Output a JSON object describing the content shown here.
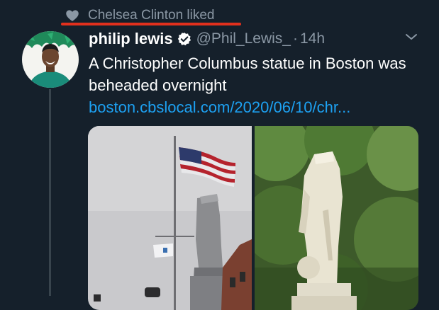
{
  "social_context": {
    "icon": "heart-icon",
    "text": "Chelsea Clinton liked"
  },
  "tweet": {
    "author": {
      "display_name": "philip lewis",
      "handle": "@Phil_Lewis_",
      "verified": true,
      "avatar": "avatar"
    },
    "separator": "·",
    "time": "14h",
    "text": "A Christopher Columbus statue in Boston was beheaded overnight",
    "link": "boston.cbslocal.com/2020/06/10/chr...",
    "media": [
      {
        "icon": "statue-photo-flag"
      },
      {
        "icon": "statue-photo-trees"
      }
    ]
  },
  "colors": {
    "background": "#15202b",
    "primary_text": "#ffffff",
    "secondary_text": "#8b98a5",
    "link": "#1da1f2",
    "verified": "#ffffff",
    "annotation_underline": "#e2301d"
  }
}
